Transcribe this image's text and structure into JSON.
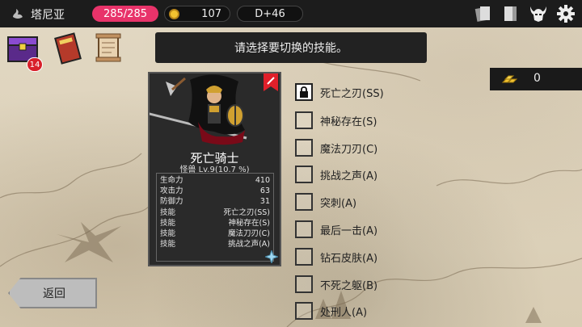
{
  "topbar": {
    "location": "塔尼亚",
    "hp": "285/285",
    "gold": "107",
    "day": "D+46",
    "icons": [
      "cards-icon",
      "journal-icon",
      "demon-helmet-icon",
      "settings-gear-icon"
    ]
  },
  "inventory": {
    "chest_badge": "14",
    "icons": [
      "treasure-chest-icon",
      "spellbook-icon",
      "scroll-icon"
    ]
  },
  "banner": {
    "message": "请选择要切换的技能。"
  },
  "resource": {
    "value": "0",
    "icon": "gold-bars-icon"
  },
  "card": {
    "name": "死亡骑士",
    "subtitle": "怪兽 Lv.9(10.7 %)",
    "stats": [
      {
        "label": "生命力",
        "value": "410"
      },
      {
        "label": "攻击力",
        "value": "63"
      },
      {
        "label": "防御力",
        "value": "31"
      },
      {
        "label": "技能",
        "value": "死亡之刃(SS)"
      },
      {
        "label": "技能",
        "value": "神秘存在(S)"
      },
      {
        "label": "技能",
        "value": "魔法刀刃(C)"
      },
      {
        "label": "技能",
        "value": "挑战之声(A)"
      }
    ]
  },
  "skills": [
    {
      "label": "死亡之刃(SS)",
      "locked": true
    },
    {
      "label": "神秘存在(S)",
      "locked": false
    },
    {
      "label": "魔法刀刃(C)",
      "locked": false
    },
    {
      "label": "挑战之声(A)",
      "locked": false
    },
    {
      "label": "突刺(A)",
      "locked": false
    },
    {
      "label": "最后一击(A)",
      "locked": false
    },
    {
      "label": "钻石皮肤(A)",
      "locked": false
    },
    {
      "label": "不死之躯(B)",
      "locked": false
    },
    {
      "label": "处刑人(A)",
      "locked": false
    }
  ],
  "back_button": {
    "label": "返回"
  },
  "colors": {
    "hp": "#e8336a",
    "badge": "#d8202a",
    "bar": "#1c1c1c"
  }
}
